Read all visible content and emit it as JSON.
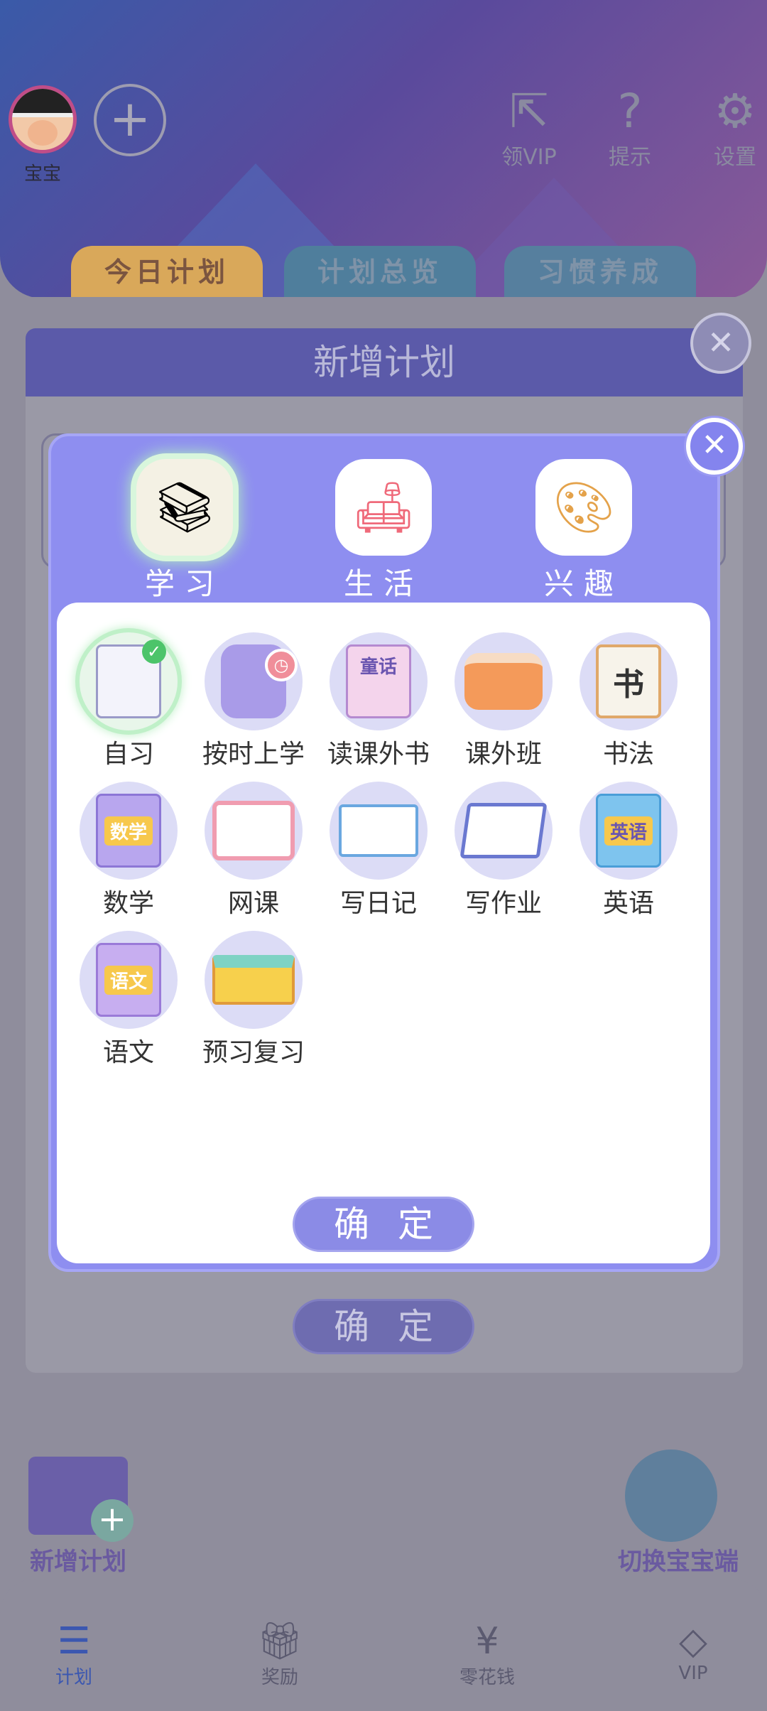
{
  "header": {
    "avatar_name": "宝宝",
    "add_symbol": "+",
    "actions": [
      {
        "label": "领VIP",
        "icon": "share-icon"
      },
      {
        "label": "提示",
        "icon": "lightbulb-icon"
      },
      {
        "label": "设置",
        "icon": "gear-icon"
      }
    ]
  },
  "tabs": [
    {
      "label": "今日计划",
      "active": true
    },
    {
      "label": "计划总览",
      "active": false
    },
    {
      "label": "习惯养成",
      "active": false
    }
  ],
  "add_plan_dialog": {
    "title": "新增计划",
    "close_symbol": "✕",
    "confirm_label": "确定"
  },
  "category_dialog": {
    "close_symbol": "✕",
    "categories": [
      {
        "label": "学习",
        "icon": "books-icon",
        "active": true
      },
      {
        "label": "生活",
        "icon": "sofa-icon",
        "active": false
      },
      {
        "label": "兴趣",
        "icon": "palette-icon",
        "active": false
      }
    ],
    "items": [
      {
        "label": "自习",
        "icon": "notebook-check-icon",
        "selected": true
      },
      {
        "label": "按时上学",
        "icon": "backpack-clock-icon",
        "selected": false
      },
      {
        "label": "读课外书",
        "icon": "fairy-tale-book-icon",
        "cover_text": "童话",
        "selected": false
      },
      {
        "label": "课外班",
        "icon": "drum-icon",
        "selected": false
      },
      {
        "label": "书法",
        "icon": "calligraphy-board-icon",
        "selected": false
      },
      {
        "label": "数学",
        "icon": "math-book-icon",
        "cover_text": "数学",
        "selected": false
      },
      {
        "label": "网课",
        "icon": "monitor-icon",
        "selected": false
      },
      {
        "label": "写日记",
        "icon": "diary-icon",
        "selected": false
      },
      {
        "label": "写作业",
        "icon": "homework-pen-icon",
        "selected": false
      },
      {
        "label": "英语",
        "icon": "english-book-icon",
        "cover_text": "英语",
        "selected": false
      },
      {
        "label": "语文",
        "icon": "chinese-book-icon",
        "cover_text": "语文",
        "selected": false
      },
      {
        "label": "预习复习",
        "icon": "book-stack-icon",
        "selected": false
      }
    ],
    "confirm_label": "确定"
  },
  "bottom_actions": {
    "new_plan": "新增计划",
    "switch_child": "切换宝宝端"
  },
  "bottom_nav": [
    {
      "label": "计划",
      "icon": "plan-icon",
      "active": true
    },
    {
      "label": "奖励",
      "icon": "gift-icon",
      "active": false
    },
    {
      "label": "零花钱",
      "icon": "yen-icon",
      "active": false
    },
    {
      "label": "VIP",
      "icon": "diamond-icon",
      "active": false
    }
  ],
  "colors": {
    "accent": "#8e8ef0",
    "selected_glow": "#bff0c8",
    "dialog_header": "#5b5aa9",
    "overlay": "#8f8d9c"
  }
}
